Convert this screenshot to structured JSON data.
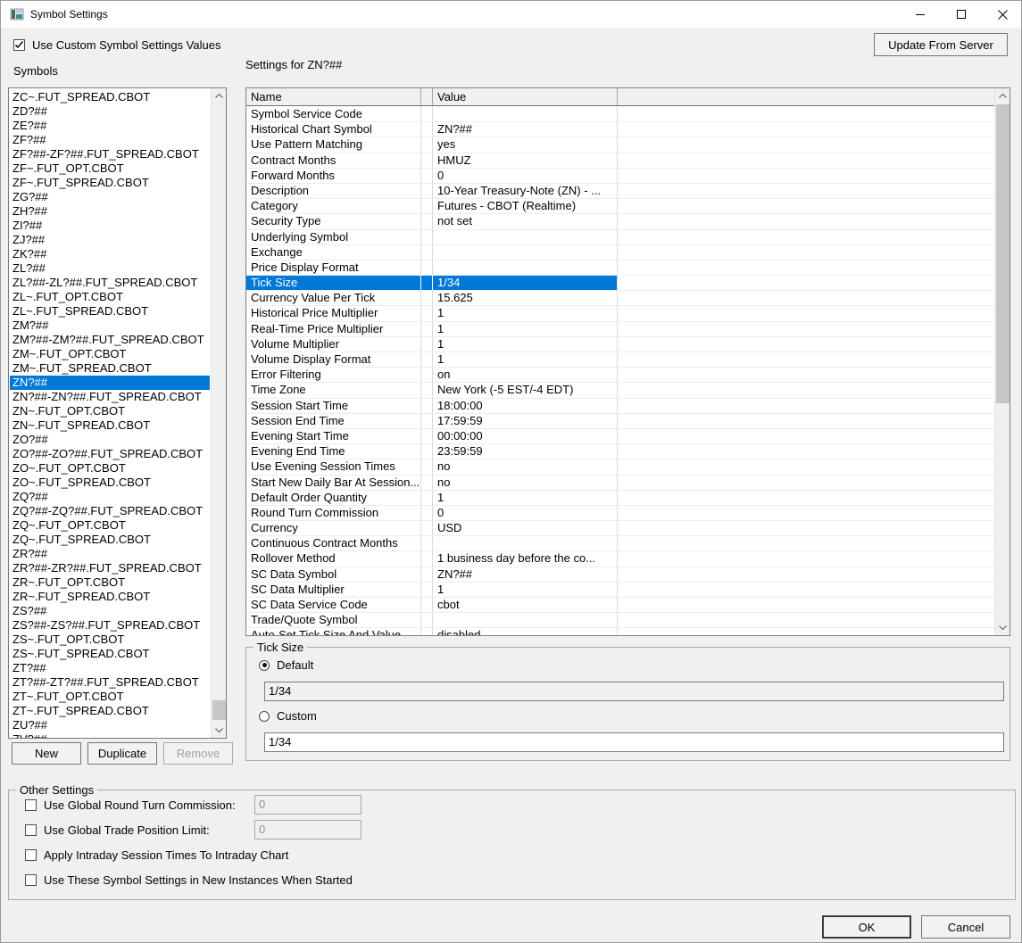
{
  "window": {
    "title": "Symbol Settings"
  },
  "titlebar": {
    "icons": {
      "app": "app-window-icon",
      "minimize": "minimize-icon",
      "maximize": "maximize-icon",
      "close": "close-icon"
    }
  },
  "header": {
    "use_custom_checkbox": {
      "label": "Use Custom Symbol Settings Values",
      "checked": true
    },
    "update_button_label": "Update From Server",
    "symbols_label": "Symbols",
    "settings_for_label": "Settings for ZN?##"
  },
  "symbols": {
    "selected": "ZN?##",
    "items": [
      "ZC~.FUT_SPREAD.CBOT",
      "ZD?##",
      "ZE?##",
      "ZF?##",
      "ZF?##-ZF?##.FUT_SPREAD.CBOT",
      "ZF~.FUT_OPT.CBOT",
      "ZF~.FUT_SPREAD.CBOT",
      "ZG?##",
      "ZH?##",
      "ZI?##",
      "ZJ?##",
      "ZK?##",
      "ZL?##",
      "ZL?##-ZL?##.FUT_SPREAD.CBOT",
      "ZL~.FUT_OPT.CBOT",
      "ZL~.FUT_SPREAD.CBOT",
      "ZM?##",
      "ZM?##-ZM?##.FUT_SPREAD.CBOT",
      "ZM~.FUT_OPT.CBOT",
      "ZM~.FUT_SPREAD.CBOT",
      "ZN?##",
      "ZN?##-ZN?##.FUT_SPREAD.CBOT",
      "ZN~.FUT_OPT.CBOT",
      "ZN~.FUT_SPREAD.CBOT",
      "ZO?##",
      "ZO?##-ZO?##.FUT_SPREAD.CBOT",
      "ZO~.FUT_OPT.CBOT",
      "ZO~.FUT_SPREAD.CBOT",
      "ZQ?##",
      "ZQ?##-ZQ?##.FUT_SPREAD.CBOT",
      "ZQ~.FUT_OPT.CBOT",
      "ZQ~.FUT_SPREAD.CBOT",
      "ZR?##",
      "ZR?##-ZR?##.FUT_SPREAD.CBOT",
      "ZR~.FUT_OPT.CBOT",
      "ZR~.FUT_SPREAD.CBOT",
      "ZS?##",
      "ZS?##-ZS?##.FUT_SPREAD.CBOT",
      "ZS~.FUT_OPT.CBOT",
      "ZS~.FUT_SPREAD.CBOT",
      "ZT?##",
      "ZT?##-ZT?##.FUT_SPREAD.CBOT",
      "ZT~.FUT_OPT.CBOT",
      "ZT~.FUT_SPREAD.CBOT",
      "ZU?##",
      "ZV?##"
    ]
  },
  "list_buttons": {
    "new": "New",
    "duplicate": "Duplicate",
    "remove": "Remove"
  },
  "settings_table": {
    "columns": [
      "Name",
      "Value"
    ],
    "rows": [
      {
        "n": "Symbol Service Code",
        "v": ""
      },
      {
        "n": "Historical Chart Symbol",
        "v": "ZN?##"
      },
      {
        "n": "Use Pattern Matching",
        "v": "yes"
      },
      {
        "n": "Contract Months",
        "v": "HMUZ"
      },
      {
        "n": "Forward Months",
        "v": "0"
      },
      {
        "n": "Description",
        "v": "10-Year Treasury-Note (ZN) - ..."
      },
      {
        "n": "Category",
        "v": "Futures - CBOT (Realtime)"
      },
      {
        "n": "Security Type",
        "v": "not set"
      },
      {
        "n": "Underlying Symbol",
        "v": ""
      },
      {
        "n": "Exchange",
        "v": ""
      },
      {
        "n": "Price Display Format",
        "v": ""
      },
      {
        "n": "Tick Size",
        "v": "1/34",
        "sel": true
      },
      {
        "n": "Currency Value Per Tick",
        "v": "15.625"
      },
      {
        "n": "Historical Price Multiplier",
        "v": "1"
      },
      {
        "n": "Real-Time Price Multiplier",
        "v": "1"
      },
      {
        "n": "Volume Multiplier",
        "v": "1"
      },
      {
        "n": "Volume Display Format",
        "v": "1"
      },
      {
        "n": "Error Filtering",
        "v": "on"
      },
      {
        "n": "Time Zone",
        "v": "New York (-5 EST/-4 EDT)"
      },
      {
        "n": "Session Start Time",
        "v": "18:00:00"
      },
      {
        "n": "Session End Time",
        "v": "17:59:59"
      },
      {
        "n": "Evening Start Time",
        "v": "00:00:00"
      },
      {
        "n": "Evening End Time",
        "v": "23:59:59"
      },
      {
        "n": "Use Evening Session Times",
        "v": "no"
      },
      {
        "n": "Start New Daily Bar At Session...",
        "v": "no"
      },
      {
        "n": "Default Order Quantity",
        "v": "1"
      },
      {
        "n": "Round Turn Commission",
        "v": "0"
      },
      {
        "n": "Currency",
        "v": "USD"
      },
      {
        "n": "Continuous Contract Months",
        "v": ""
      },
      {
        "n": "Rollover Method",
        "v": "1 business day before the co..."
      },
      {
        "n": "SC Data Symbol",
        "v": "ZN?##"
      },
      {
        "n": "SC Data Multiplier",
        "v": "1"
      },
      {
        "n": "SC Data Service Code",
        "v": "cbot"
      },
      {
        "n": "Trade/Quote Symbol",
        "v": ""
      },
      {
        "n": "Auto-Set Tick Size And Value",
        "v": "disabled"
      }
    ]
  },
  "tick_size_group": {
    "legend": "Tick Size",
    "default_radio_label": "Default",
    "default_value": "1/34",
    "default_selected": true,
    "custom_radio_label": "Custom",
    "custom_value": "1/34",
    "custom_selected": false
  },
  "other_settings": {
    "legend": "Other Settings",
    "items": [
      {
        "label": "Use Global Round Turn Commission:",
        "value": "0"
      },
      {
        "label": "Use Global Trade Position Limit:",
        "value": "0"
      },
      {
        "label": "Apply Intraday Session Times To Intraday Chart"
      },
      {
        "label": "Use These Symbol Settings in New Instances When Started"
      }
    ]
  },
  "footer": {
    "ok": "OK",
    "cancel": "Cancel"
  },
  "colors": {
    "selection": "#0078d7",
    "dialog_bg": "#f0f0f0",
    "titlebar_bg": "#ffffff"
  }
}
